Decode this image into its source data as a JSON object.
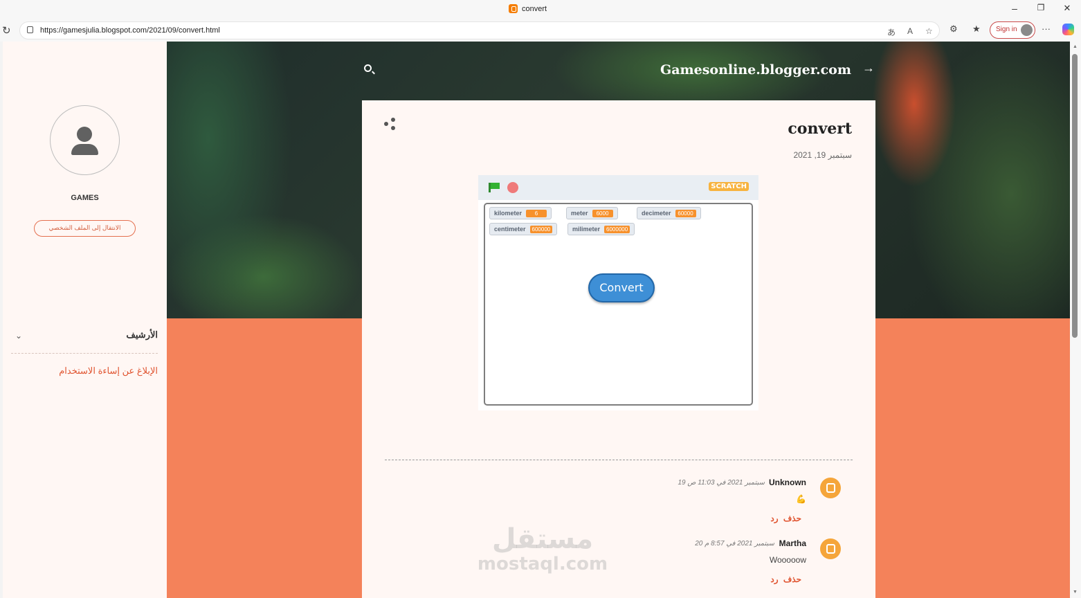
{
  "browser": {
    "tab_title": "convert",
    "url": "https://gamesjulia.blogspot.com/2021/09/convert.html",
    "sign_in": "Sign in",
    "minimize": "–",
    "restore": "❐",
    "close": "✕"
  },
  "blog": {
    "header_title": "Gamesonline.blogger.com"
  },
  "sidebar": {
    "profile_name": "GAMES",
    "profile_button": "الانتقال إلى الملف الشخصي",
    "archive_label": "الأرشيف",
    "report_link": "الإبلاغ عن إساءة الاستخدام"
  },
  "post": {
    "title": "convert",
    "date": "سبتمبر 19, 2021"
  },
  "scratch": {
    "logo": "SCRATCH",
    "button_label": "Convert",
    "monitors": [
      {
        "label": "kilometer",
        "value": "6"
      },
      {
        "label": "meter",
        "value": "6000"
      },
      {
        "label": "decimeter",
        "value": "60000"
      },
      {
        "label": "centimeter",
        "value": "600000"
      },
      {
        "label": "milimeter",
        "value": "6000000"
      }
    ]
  },
  "comments": [
    {
      "author": "Unknown",
      "date": "19 سبتمبر 2021 في 11:03 ص",
      "body": "💪",
      "reply": "رد",
      "delete": "حذف"
    },
    {
      "author": "Martha",
      "date": "20 سبتمبر 2021 في 8:57 م",
      "body": "Wooooow",
      "reply": "رد",
      "delete": "حذف"
    }
  ],
  "watermark": {
    "arabic": "مستقل",
    "latin": "mostaql.com"
  },
  "colors": {
    "accent": "#e0532f",
    "page_bg": "#f4825a",
    "card_bg": "#fff7f4"
  }
}
